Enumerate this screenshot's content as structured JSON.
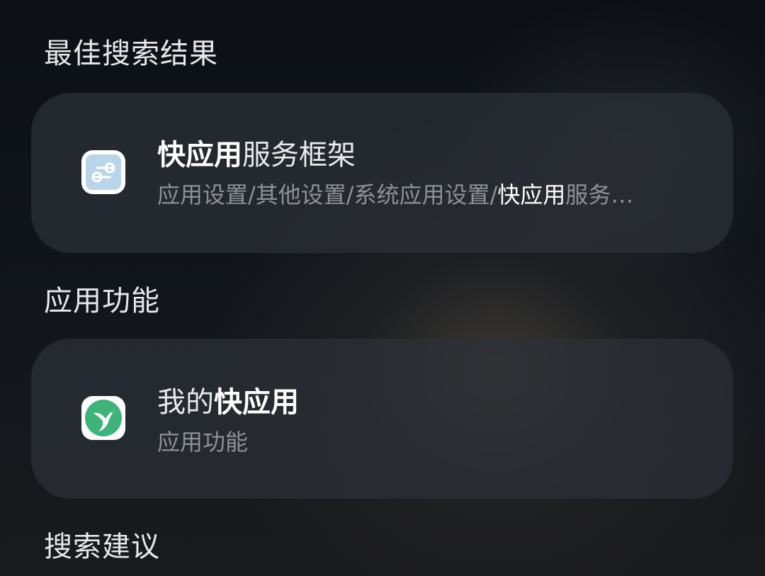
{
  "sections": {
    "best_results": {
      "title": "最佳搜索结果"
    },
    "app_features": {
      "title": "应用功能"
    },
    "suggestions": {
      "title": "搜索建议"
    }
  },
  "best_result_card": {
    "icon": "toggle-settings-icon",
    "title_highlight": "快应用",
    "title_rest": "服务框架",
    "subtitle_prefix": "应用设置/其他设置/系统应用设置/",
    "subtitle_highlight": "快应用",
    "subtitle_rest": "服务…"
  },
  "feature_card": {
    "icon": "hummingbird-icon",
    "title_prefix": "我的",
    "title_highlight": "快应用",
    "subtitle": "应用功能"
  },
  "colors": {
    "background": "#10141b",
    "card": "#2c3038",
    "highlight": "#ffffff",
    "secondary_text": "#8e9196",
    "icon_light_blue": "#b9d6e8",
    "icon_green": "#3fb37a"
  }
}
